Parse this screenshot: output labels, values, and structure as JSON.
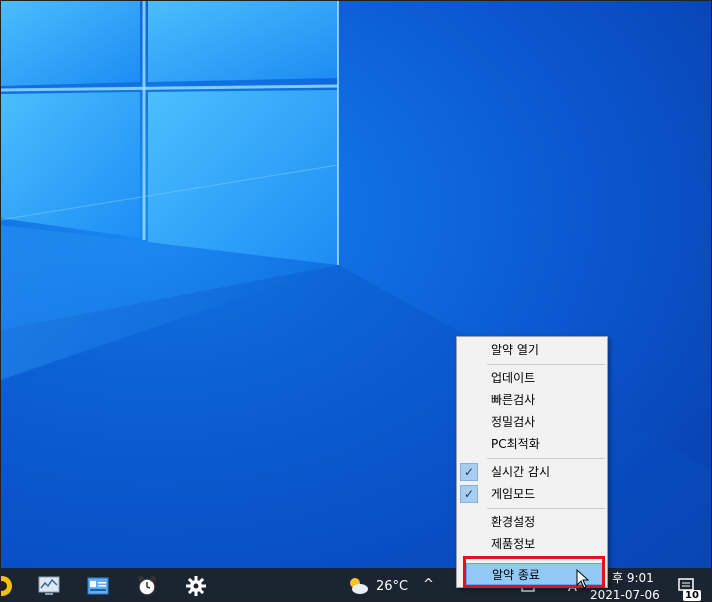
{
  "context_menu": {
    "items": [
      {
        "label": "알약 열기",
        "checked": false
      },
      {
        "label": "업데이트",
        "checked": false
      },
      {
        "label": "빠른검사",
        "checked": false
      },
      {
        "label": "정밀검사",
        "checked": false
      },
      {
        "label": "PC최적화",
        "checked": false
      },
      {
        "label": "실시간 감시",
        "checked": true
      },
      {
        "label": "게임모드",
        "checked": true
      },
      {
        "label": "환경설정",
        "checked": false
      },
      {
        "label": "제품정보",
        "checked": false
      },
      {
        "label": "알약 종료",
        "checked": false,
        "highlighted": true
      }
    ],
    "check_glyph": "✓"
  },
  "taskbar": {
    "weather": {
      "temperature": "26°C",
      "icon": "partly-cloudy-icon"
    },
    "tray_chevron": "^",
    "clock": {
      "time": "후 9:01",
      "date": "2021-07-06"
    },
    "notification_count": "10",
    "pinned_icons": [
      "app-icon",
      "performance-monitor-icon",
      "system-info-icon",
      "clock-app-icon",
      "settings-gear-icon"
    ]
  },
  "colors": {
    "accent_highlight": "#91c9f7",
    "annotation_red": "#e3101e",
    "taskbar_bg": "#1b2431",
    "desktop_blue": "#0b57cf"
  }
}
